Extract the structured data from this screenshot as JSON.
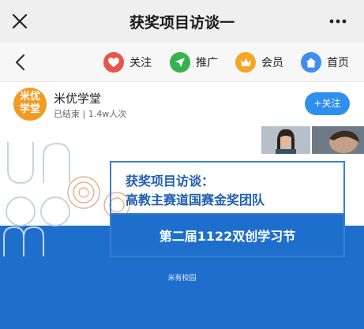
{
  "titlebar": {
    "title": "获奖项目访谈一",
    "close_icon": "close-icon",
    "more_icon": "more-icon"
  },
  "navbar": {
    "items": [
      {
        "label": "关注",
        "icon": "heart-icon",
        "color": "#e8534a"
      },
      {
        "label": "推广",
        "icon": "send-icon",
        "color": "#37b24d"
      },
      {
        "label": "会员",
        "icon": "crown-icon",
        "color": "#f5a623"
      },
      {
        "label": "首页",
        "icon": "home-icon",
        "color": "#3d8ef0"
      }
    ]
  },
  "channel": {
    "avatar_text": "米优学堂",
    "name": "米优学堂",
    "status": "已结束 | 1.4w人次",
    "follow_label": "+关注"
  },
  "slide": {
    "title": "获奖项目访谈：",
    "subtitle": "高教主赛道国赛金奖团队",
    "event": "第二届1122双创学习节",
    "org": "米有校园"
  }
}
